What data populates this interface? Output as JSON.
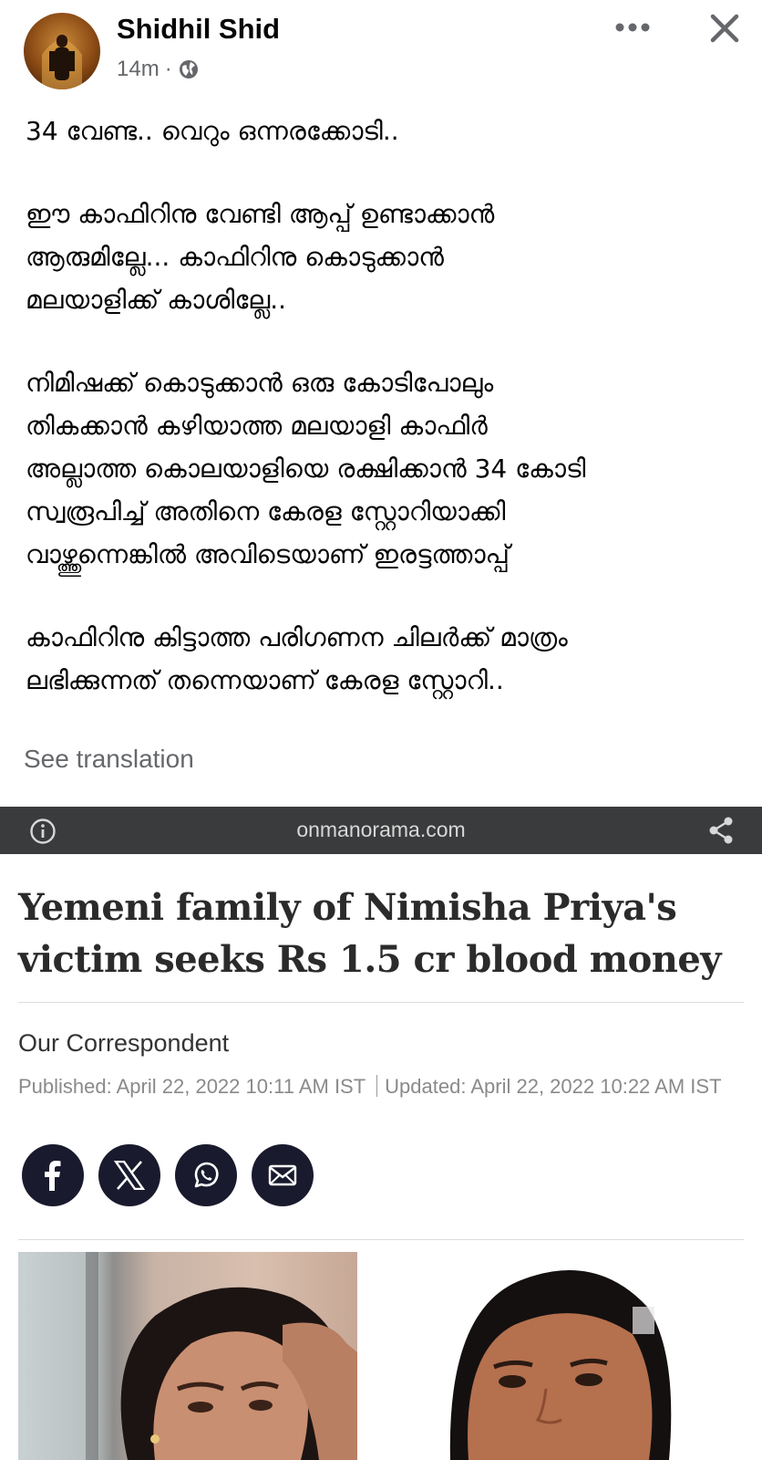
{
  "post": {
    "author": "Shidhil Shid",
    "time": "14m",
    "audience_icon": "globe-icon",
    "paragraphs": [
      "34 വേണ്ട.. വെറും ഒന്നരക്കോടി..",
      "ഈ കാഫിറിനു വേണ്ടി ആപ്പ് ഉണ്ടാക്കാൻ\nആരുമില്ലേ... കാഫിറിനു കൊടുക്കാൻ\nമലയാളിക്ക് കാശില്ലേ..",
      "നിമിഷക്ക് കൊടുക്കാൻ ഒരു കോടിപോലും\nതികക്കാൻ കഴിയാത്ത മലയാളി കാഫിർ\nഅല്ലാത്ത കൊലയാളിയെ രക്ഷിക്കാൻ 34 കോടി\nസ്വരൂപിച്ച് അതിനെ കേരള സ്റ്റോറിയാക്കി\nവാഴ്ത്തുന്നെങ്കിൽ അവിടെയാണ് ഇരട്ടത്താപ്പ്",
      "കാഫിറിനു കിട്ടാത്ത പരിഗണന ചിലർക്ക് മാത്രം\nലഭിക്കുന്നത് തന്നെയാണ് കേരള സ്റ്റോറി.."
    ],
    "see_translation": "See translation"
  },
  "shared_link": {
    "domain": "onmanorama.com"
  },
  "article": {
    "headline": "Yemeni family of Nimisha Priya's victim seeks Rs 1.5 cr blood money",
    "byline": "Our Correspondent",
    "published": "Published: April 22, 2022 10:11 AM IST",
    "updated": "Updated: April 22, 2022 10:22 AM IST",
    "share_buttons": [
      "facebook-icon",
      "x-icon",
      "whatsapp-icon",
      "mail-icon"
    ]
  },
  "colors": {
    "link_bar": "#3a3b3c",
    "secondary_text": "#65676b",
    "share_circle": "#1a1a2e"
  }
}
